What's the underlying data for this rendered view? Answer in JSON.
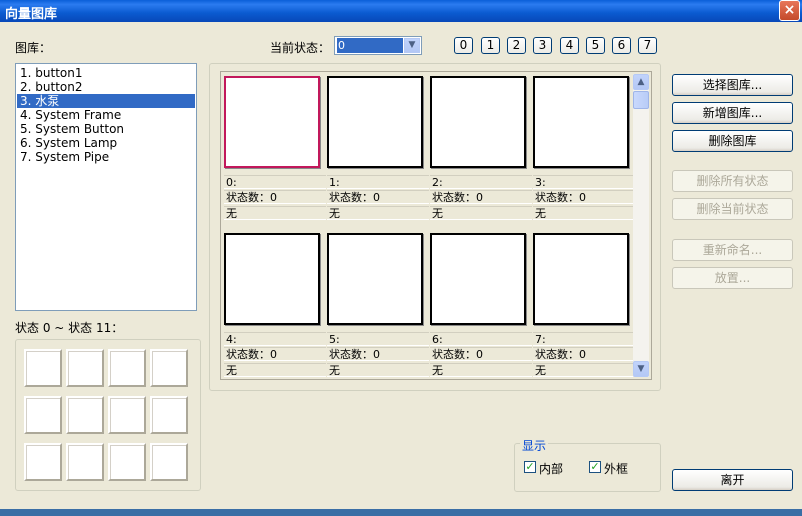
{
  "window": {
    "title": "向量图库",
    "close_icon": "×"
  },
  "library": {
    "label": "图库：",
    "items": [
      "1. button1",
      "2. button2",
      "3. 水泵",
      "4. System Frame",
      "5. System Button",
      "6. System Lamp",
      "7. System Pipe"
    ],
    "selected_index": 2
  },
  "states_preview": {
    "label": "状态 0 ~ 状态 11："
  },
  "current_state": {
    "label": "当前状态：",
    "value": "0",
    "arrow": "▼"
  },
  "state_buttons": [
    "0",
    "1",
    "2",
    "3",
    "4",
    "5",
    "6",
    "7"
  ],
  "gallery": {
    "cells": [
      {
        "index": "0:",
        "count": "状态数：0",
        "desc": "无",
        "selected": true
      },
      {
        "index": "1:",
        "count": "状态数：0",
        "desc": "无",
        "selected": false
      },
      {
        "index": "2:",
        "count": "状态数：0",
        "desc": "无",
        "selected": false
      },
      {
        "index": "3:",
        "count": "状态数：0",
        "desc": "无",
        "selected": false
      },
      {
        "index": "4:",
        "count": "状态数：0",
        "desc": "无",
        "selected": false
      },
      {
        "index": "5:",
        "count": "状态数：0",
        "desc": "无",
        "selected": false
      },
      {
        "index": "6:",
        "count": "状态数：0",
        "desc": "无",
        "selected": false
      },
      {
        "index": "7:",
        "count": "状态数：0",
        "desc": "无",
        "selected": false
      }
    ],
    "scroll_up": "▲",
    "scroll_down": "▼"
  },
  "buttons": {
    "select_library": "选择图库...",
    "new_library": "新增图库...",
    "delete_library": "删除图库",
    "delete_all_states": "删除所有状态",
    "delete_current_state": "删除当前状态",
    "rename": "重新命名...",
    "place": "放置...",
    "leave": "离开"
  },
  "display": {
    "legend": "显示",
    "inner": {
      "label": "内部",
      "checked": true
    },
    "frame": {
      "label": "外框",
      "checked": true
    },
    "check_mark": "✓"
  },
  "colors": {
    "title_bar": "#0A5FD8",
    "selection": "#316AC5",
    "selected_cell_border": "#C2185B"
  }
}
